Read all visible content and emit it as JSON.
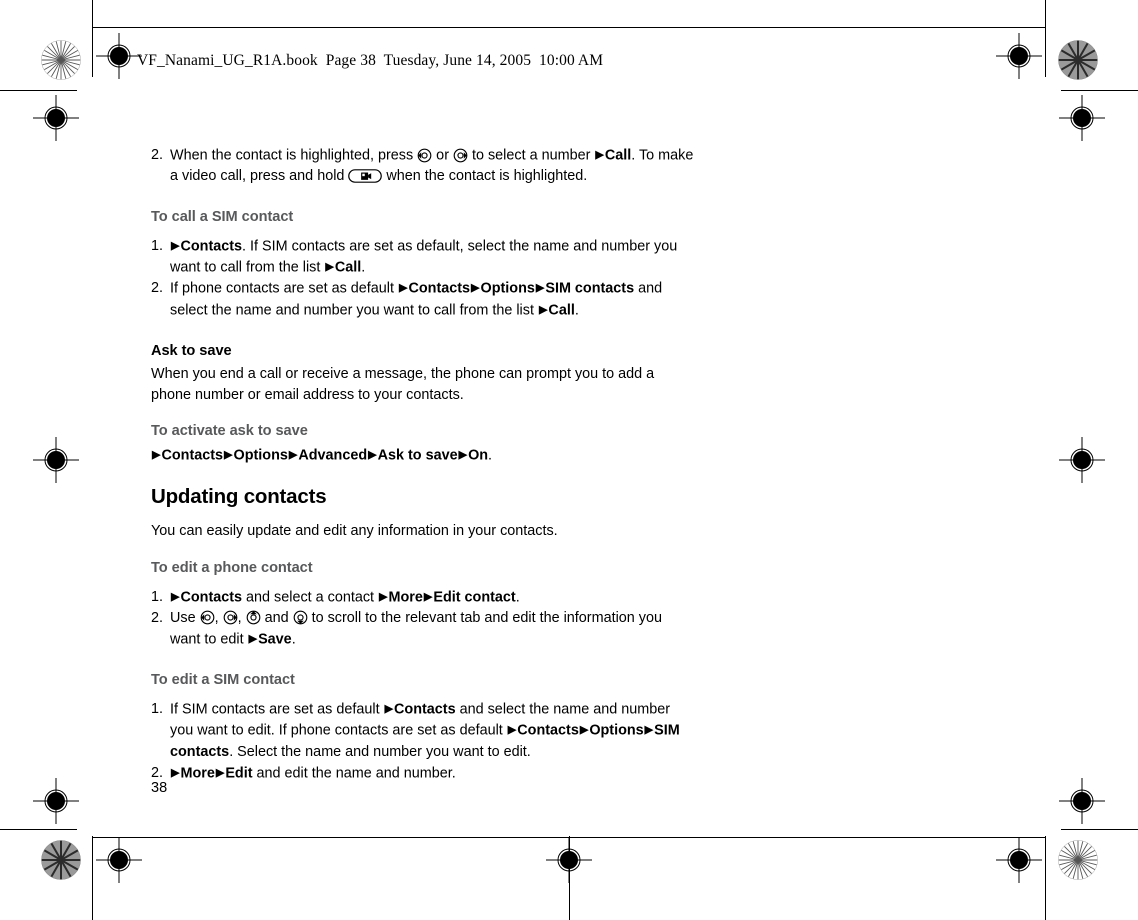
{
  "file_header": "VF_Nanami_UG_R1A.book  Page 38  Tuesday, June 14, 2005  10:00 AM",
  "page_number": "38",
  "icons": {
    "nav_left": "nav-key-left-icon",
    "nav_right": "nav-key-right-icon",
    "nav_up": "nav-key-up-icon",
    "nav_down": "nav-key-down-icon",
    "video_call_key": "video-call-key-icon",
    "arrow": "▶"
  },
  "colors": {
    "text": "#000000",
    "subheading_gray": "#58595b",
    "rule": "#000000"
  },
  "content": {
    "step_top": {
      "number": "2.",
      "t1": "When the contact is highlighted, press ",
      "t2": " or ",
      "t3": " to select a number ",
      "call": "Call",
      "t4": ". To make a video call, press and hold ",
      "t5": " when the contact is highlighted."
    },
    "sim_call": {
      "heading": "To call a SIM contact",
      "items": [
        {
          "number": "1.",
          "contacts": "Contacts",
          "t1": ". If SIM contacts are set as default, select the name and number you want to call from the list ",
          "call": "Call",
          "t2": "."
        },
        {
          "number": "2.",
          "t0": "If phone contacts are set as default ",
          "contacts": "Contacts",
          "options": "Options",
          "sim_contacts": "SIM contacts",
          "t1": " and select the name and number you want to call from the list ",
          "call": "Call",
          "t2": "."
        }
      ]
    },
    "ask_to_save": {
      "heading": "Ask to save",
      "body": "When you end a call or receive a message, the phone can prompt you to add a phone number or email address to your contacts.",
      "sub_heading": "To activate ask to save",
      "path": {
        "contacts": "Contacts",
        "options": "Options",
        "advanced": "Advanced",
        "ask_to_save": "Ask to save",
        "on": "On",
        "period": "."
      }
    },
    "updating_contacts": {
      "heading": "Updating contacts",
      "body": "You can easily update and edit any information in your contacts."
    },
    "edit_phone_contact": {
      "heading": "To edit a phone contact",
      "items": [
        {
          "number": "1.",
          "contacts": "Contacts",
          "t1": " and select a contact ",
          "more": "More",
          "edit_contact": "Edit contact",
          "t2": "."
        },
        {
          "number": "2.",
          "t0": "Use ",
          "comma1": ", ",
          "comma2": ", ",
          "and": " and ",
          "t1": " to scroll to the relevant tab and edit the information you want to edit ",
          "save": "Save",
          "t2": "."
        }
      ]
    },
    "edit_sim_contact": {
      "heading": "To edit a SIM contact",
      "items": [
        {
          "number": "1.",
          "t0": "If SIM contacts are set as default ",
          "contacts": "Contacts",
          "t1": " and select the name and number you want to edit. If phone contacts are set as default ",
          "contacts2": "Contacts",
          "options": "Options",
          "sim_contacts": "SIM contacts",
          "t2": ". Select the name and number you want to edit."
        },
        {
          "number": "2.",
          "more": "More",
          "edit": "Edit",
          "t1": " and edit the name and number."
        }
      ]
    }
  }
}
